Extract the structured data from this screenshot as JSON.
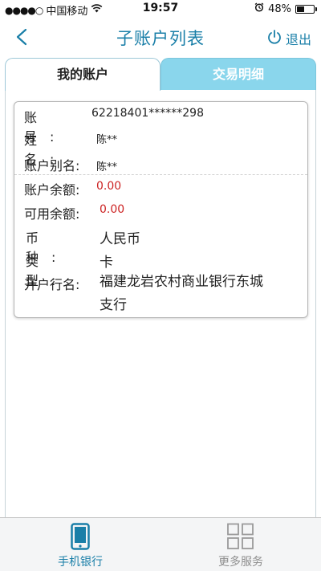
{
  "status_bar": {
    "signal": "●●●●○",
    "carrier": "中国移动",
    "time": "19:57",
    "battery": "48%",
    "battery_level": 0.48
  },
  "nav": {
    "title": "子账户列表",
    "logout_label": "退出"
  },
  "tabs": [
    {
      "label": "我的账户",
      "active": true
    },
    {
      "label": "交易明细",
      "active": false
    }
  ],
  "account": {
    "fields": [
      {
        "label": "账号:",
        "value": "62218401******298"
      },
      {
        "label": "姓名:",
        "value": "陈**"
      },
      {
        "label": "账户别名:",
        "value": "陈**"
      },
      {
        "label": "账户余额:",
        "value": "0.00"
      },
      {
        "label": "可用余额:",
        "value": "0.00"
      },
      {
        "label": "币种:",
        "value": "人民币"
      },
      {
        "label": "类型:",
        "value": "卡"
      },
      {
        "label": "开户行名:",
        "value_line1": "福建龙岩农村商业银行东城",
        "value_line2": "支行"
      }
    ]
  },
  "bottom_nav": [
    {
      "label": "手机银行",
      "icon": "phone-icon",
      "active": true
    },
    {
      "label": "更多服务",
      "icon": "grid-icon",
      "active": false
    }
  ],
  "colors": {
    "accent": "#1a7fa8",
    "tab_inactive": "#8ad6ec",
    "balance_red": "#cc2222"
  }
}
